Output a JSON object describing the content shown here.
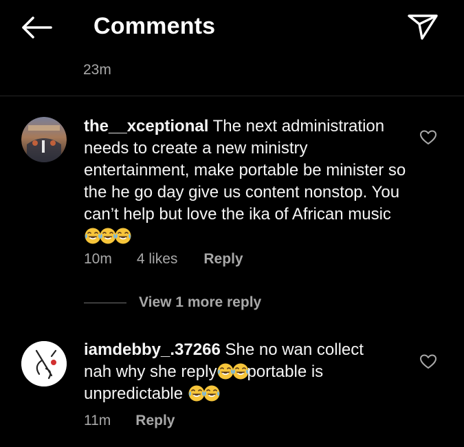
{
  "header": {
    "title": "Comments",
    "back_icon": "arrow-left-icon",
    "share_icon": "paper-plane-icon"
  },
  "top_timestamp": "23m",
  "comments": [
    {
      "username": "the__xceptional",
      "text": "The next administration needs to create a new ministry entertainment, make portable be minister so the he go day give us content nonstop. You can’t help but love the ika of African music",
      "emoji_count": 3,
      "time": "10m",
      "likes": "4 likes",
      "reply_label": "Reply",
      "view_more_label": "View 1 more reply"
    },
    {
      "username": "iamdebby_.37266",
      "text_part1": "She no wan collect nah why she reply",
      "text_part2": "portable is unpredictable",
      "time": "11m",
      "reply_label": "Reply"
    }
  ],
  "colors": {
    "background": "#000000",
    "text": "#f5f5f5",
    "secondary_text": "#a8a8a8",
    "divider": "#262626"
  }
}
